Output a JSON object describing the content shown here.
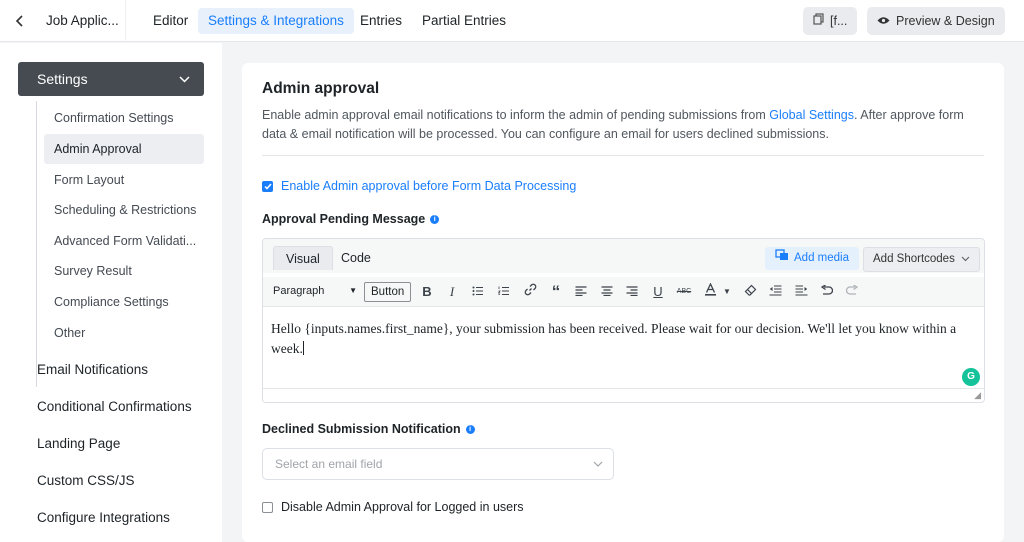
{
  "topbar": {
    "back_icon": "chevron-left-icon",
    "form_title": "Job Applic...",
    "nav": [
      "Editor",
      "Settings & Integrations",
      "Entries",
      "Partial Entries"
    ],
    "active_nav": "Settings & Integrations",
    "shortcode_btn": "[f...",
    "preview_btn": "Preview & Design"
  },
  "sidebar": {
    "settings_label": "Settings",
    "sub_items": [
      "Confirmation Settings",
      "Admin Approval",
      "Form Layout",
      "Scheduling & Restrictions",
      "Advanced Form Validati...",
      "Survey Result",
      "Compliance Settings",
      "Other"
    ],
    "active_sub": "Admin Approval",
    "main_items": [
      "Email Notifications",
      "Conditional Confirmations",
      "Landing Page",
      "Custom CSS/JS",
      "Configure Integrations"
    ]
  },
  "panel": {
    "title": "Admin approval",
    "desc_before": "Enable admin approval email notifications to inform the admin of pending submissions from ",
    "desc_link": "Global Settings",
    "desc_after": ". After approve form data & email notification will be processed. You can configure an email for users declined submissions.",
    "enable_label": "Enable Admin approval before Form Data Processing",
    "enable_checked": true,
    "pending_label": "Approval Pending Message",
    "editor": {
      "tab_visual": "Visual",
      "tab_code": "Code",
      "add_media": "Add media",
      "add_shortcodes": "Add Shortcodes",
      "format": "Paragraph",
      "button_label": "Button",
      "content": "Hello {inputs.names.first_name}, your submission has been received. Please wait for our decision. We'll let you know within a week."
    },
    "declined_label": "Declined Submission Notification",
    "email_placeholder": "Select an email field",
    "disable_label": "Disable Admin Approval for Logged in users",
    "disable_checked": false
  },
  "colors": {
    "accent": "#1a7efb",
    "sidebar_head": "#464b51",
    "grammarly": "#15c39a"
  }
}
